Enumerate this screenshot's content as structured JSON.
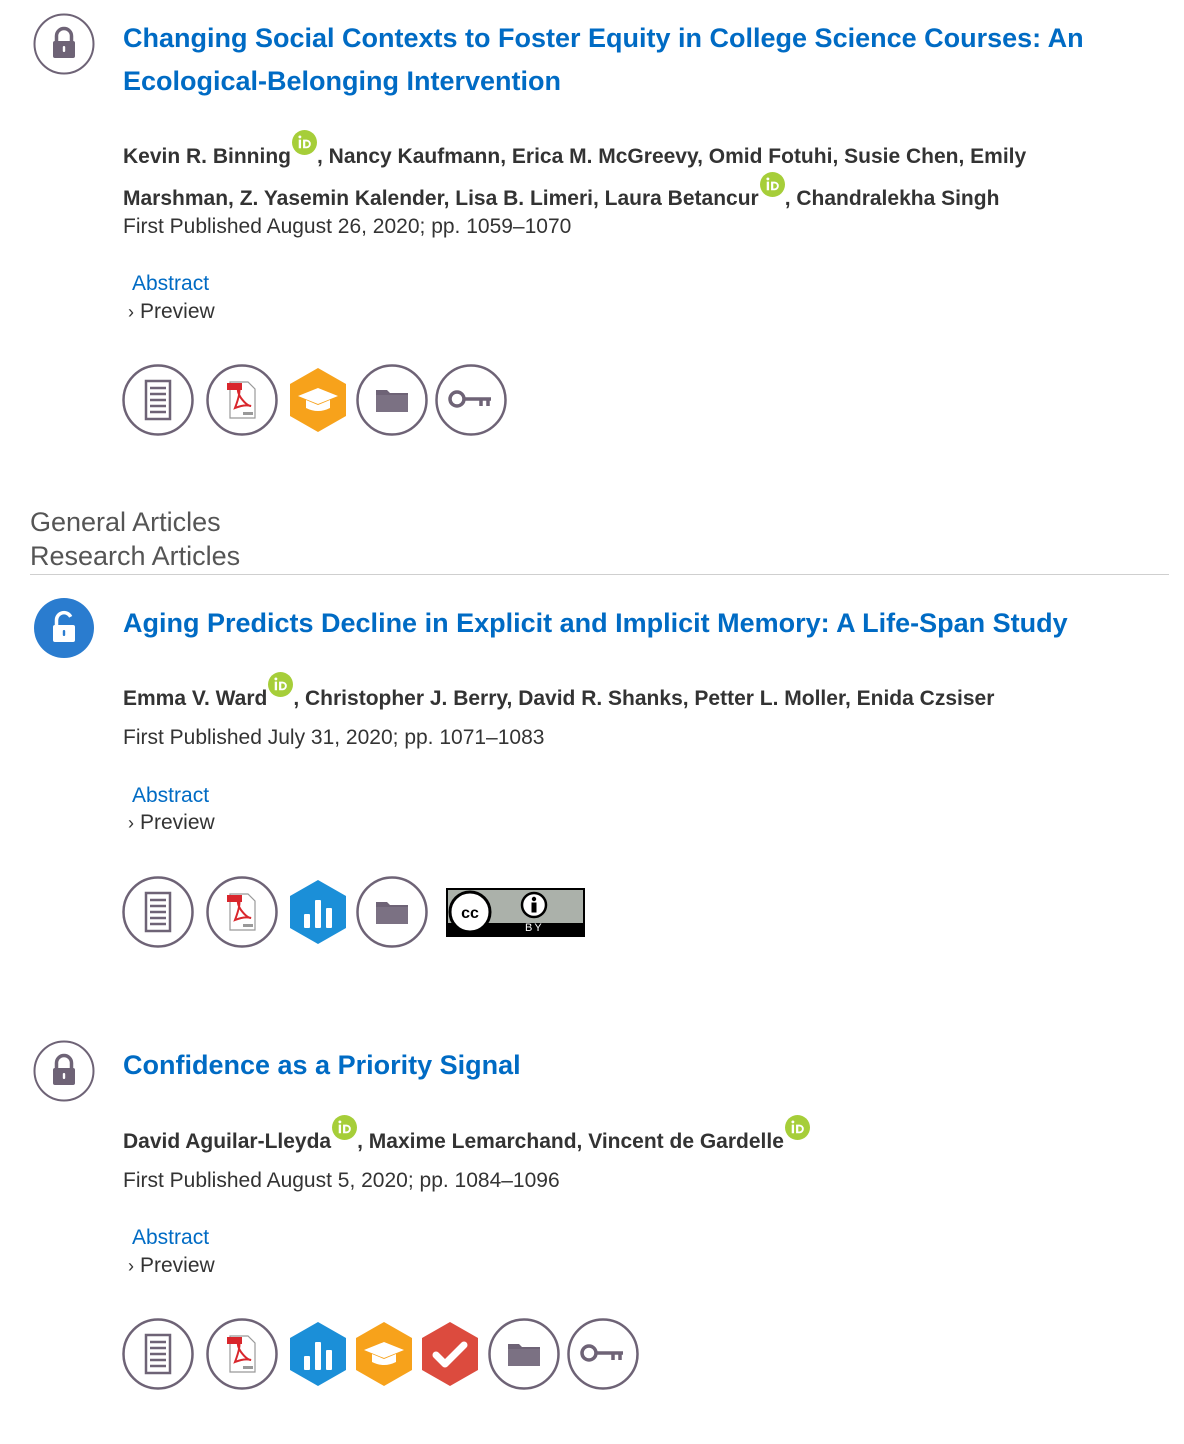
{
  "colors": {
    "link": "#006bc4",
    "text": "#333333",
    "orcid": "#a6ce39",
    "lock_gray": "#6e6376",
    "lock_blue": "#2a7ccf"
  },
  "section": {
    "heading_1": "General Articles",
    "heading_2": "Research Articles"
  },
  "articles": [
    {
      "access": "locked",
      "title": "Changing Social Contexts to Foster Equity in College Science Courses: An Ecological-Belonging Intervention",
      "authors": [
        "Kevin R. Binning",
        "Nancy Kaufmann",
        "Erica M. McGreevy",
        "Omid Fotuhi",
        "Susie Chen",
        "Emily Marshman",
        "Z. Yasemin Kalender",
        "Lisa B. Limeri",
        "Laura Betancur",
        "Chandralekha Singh"
      ],
      "published": "First Published August 26, 2020; pp. 1059–1070",
      "abstract_label": "Abstract",
      "preview_label": "Preview",
      "tools": [
        "full-text-icon",
        "pdf-icon",
        "open-materials-badge-icon",
        "supplementary-folder-icon",
        "access-key-icon"
      ]
    },
    {
      "access": "open",
      "title": "Aging Predicts Decline in Explicit and Implicit Memory: A Life-Span Study",
      "authors": [
        "Emma V. Ward",
        "Christopher J. Berry",
        "David R. Shanks",
        "Petter L. Moller",
        "Enida Czsiser"
      ],
      "published": "First Published July 31, 2020; pp. 1071–1083",
      "abstract_label": "Abstract",
      "preview_label": "Preview",
      "license_text": "BY",
      "tools": [
        "full-text-icon",
        "pdf-icon",
        "open-data-badge-icon",
        "supplementary-folder-icon",
        "cc-by-license-icon"
      ]
    },
    {
      "access": "locked",
      "title": "Confidence as a Priority Signal",
      "authors": [
        "David Aguilar-Lleyda",
        "Maxime Lemarchand",
        "Vincent de Gardelle"
      ],
      "published": "First Published August 5, 2020; pp. 1084–1096",
      "abstract_label": "Abstract",
      "preview_label": "Preview",
      "tools": [
        "full-text-icon",
        "pdf-icon",
        "open-data-badge-icon",
        "open-materials-badge-icon",
        "preregistered-badge-icon",
        "supplementary-folder-icon",
        "access-key-icon"
      ]
    }
  ]
}
